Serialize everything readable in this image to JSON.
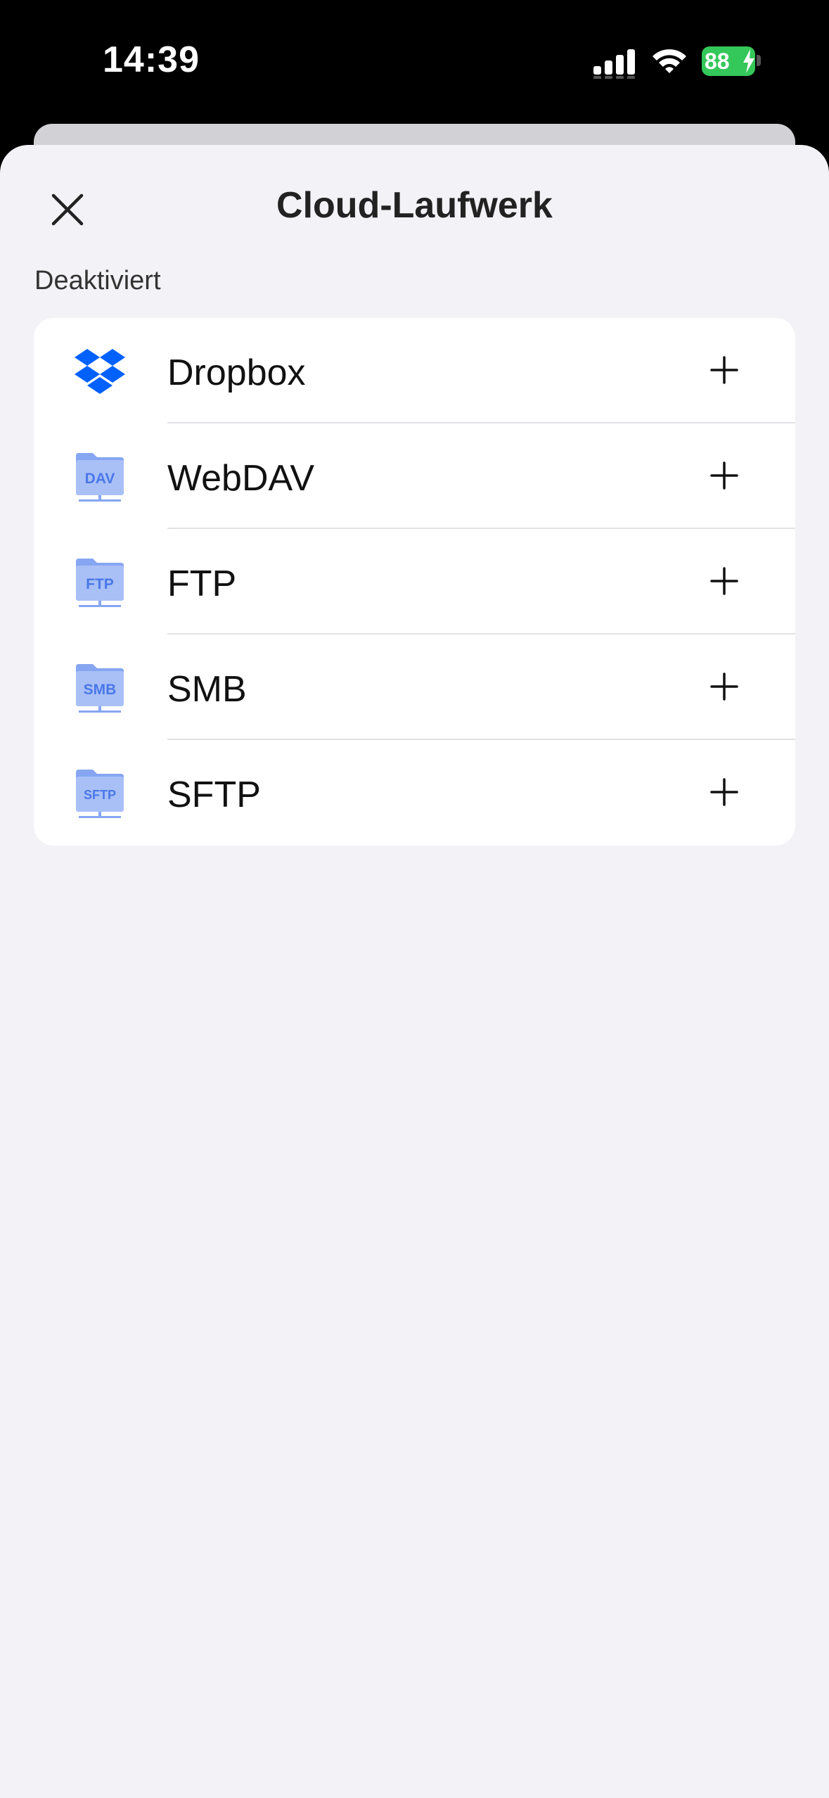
{
  "status_bar": {
    "time": "14:39",
    "battery": "88",
    "signal_icon": "cellular-signal-icon",
    "wifi_icon": "wifi-icon",
    "battery_charging": true
  },
  "sheet": {
    "title": "Cloud-Laufwerk",
    "close_icon": "close-icon",
    "section_label": "Deaktiviert"
  },
  "services": [
    {
      "label": "Dropbox",
      "icon": "dropbox-icon",
      "badge": ""
    },
    {
      "label": "WebDAV",
      "icon": "webdav-folder-icon",
      "badge": "DAV"
    },
    {
      "label": "FTP",
      "icon": "ftp-folder-icon",
      "badge": "FTP"
    },
    {
      "label": "SMB",
      "icon": "smb-folder-icon",
      "badge": "SMB"
    },
    {
      "label": "SFTP",
      "icon": "sftp-folder-icon",
      "badge": "SFTP"
    }
  ],
  "colors": {
    "dropbox_blue": "#0061fe",
    "folder_light": "#a9c0f7",
    "folder_dark": "#86a6f2",
    "folder_text": "#4a78e8",
    "battery_green": "#34c759",
    "sheet_bg": "#f2f2f7"
  }
}
